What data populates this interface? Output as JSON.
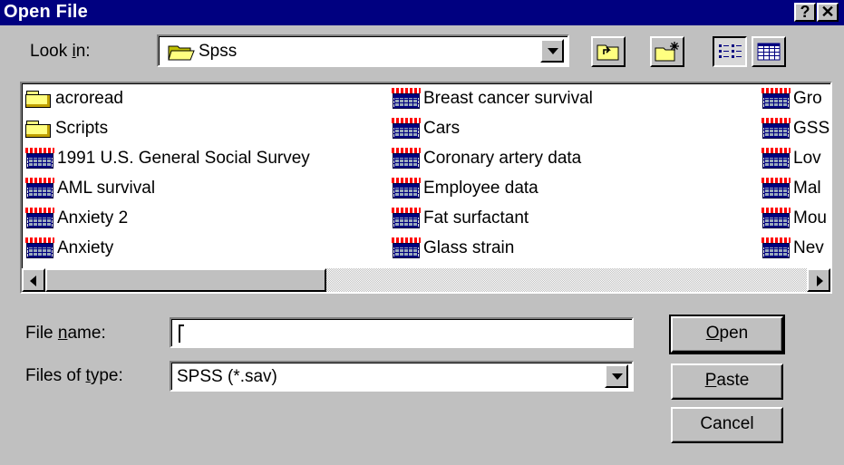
{
  "window": {
    "title": "Open File",
    "help_glyph": "?",
    "close_glyph": "✕"
  },
  "look_in": {
    "label_pre": "Look ",
    "label_acc": "i",
    "label_post": "n:",
    "value": "Spss"
  },
  "files": [
    {
      "name": "acroread",
      "kind": "folder"
    },
    {
      "name": "Scripts",
      "kind": "folder"
    },
    {
      "name": "1991 U.S. General Social Survey",
      "kind": "file"
    },
    {
      "name": "AML survival",
      "kind": "file"
    },
    {
      "name": "Anxiety 2",
      "kind": "file"
    },
    {
      "name": "Anxiety",
      "kind": "file"
    },
    {
      "name": "Breast cancer survival",
      "kind": "file"
    },
    {
      "name": "Cars",
      "kind": "file"
    },
    {
      "name": "Coronary artery data",
      "kind": "file"
    },
    {
      "name": "Employee data",
      "kind": "file"
    },
    {
      "name": "Fat surfactant",
      "kind": "file"
    },
    {
      "name": "Glass strain",
      "kind": "file"
    },
    {
      "name": "Gro",
      "kind": "file"
    },
    {
      "name": "GSS",
      "kind": "file"
    },
    {
      "name": "Lov",
      "kind": "file"
    },
    {
      "name": "Mal",
      "kind": "file"
    },
    {
      "name": "Mou",
      "kind": "file"
    },
    {
      "name": "Nev",
      "kind": "file"
    }
  ],
  "file_name": {
    "label_pre": "File ",
    "label_acc": "n",
    "label_post": "ame:",
    "value": ""
  },
  "file_type": {
    "label_pre": "Files of ",
    "label_acc": "t",
    "label_post": "ype:",
    "value": "SPSS (*.sav)"
  },
  "buttons": {
    "open_acc": "O",
    "open_rest": "pen",
    "paste_acc": "P",
    "paste_rest": "aste",
    "cancel": "Cancel"
  }
}
